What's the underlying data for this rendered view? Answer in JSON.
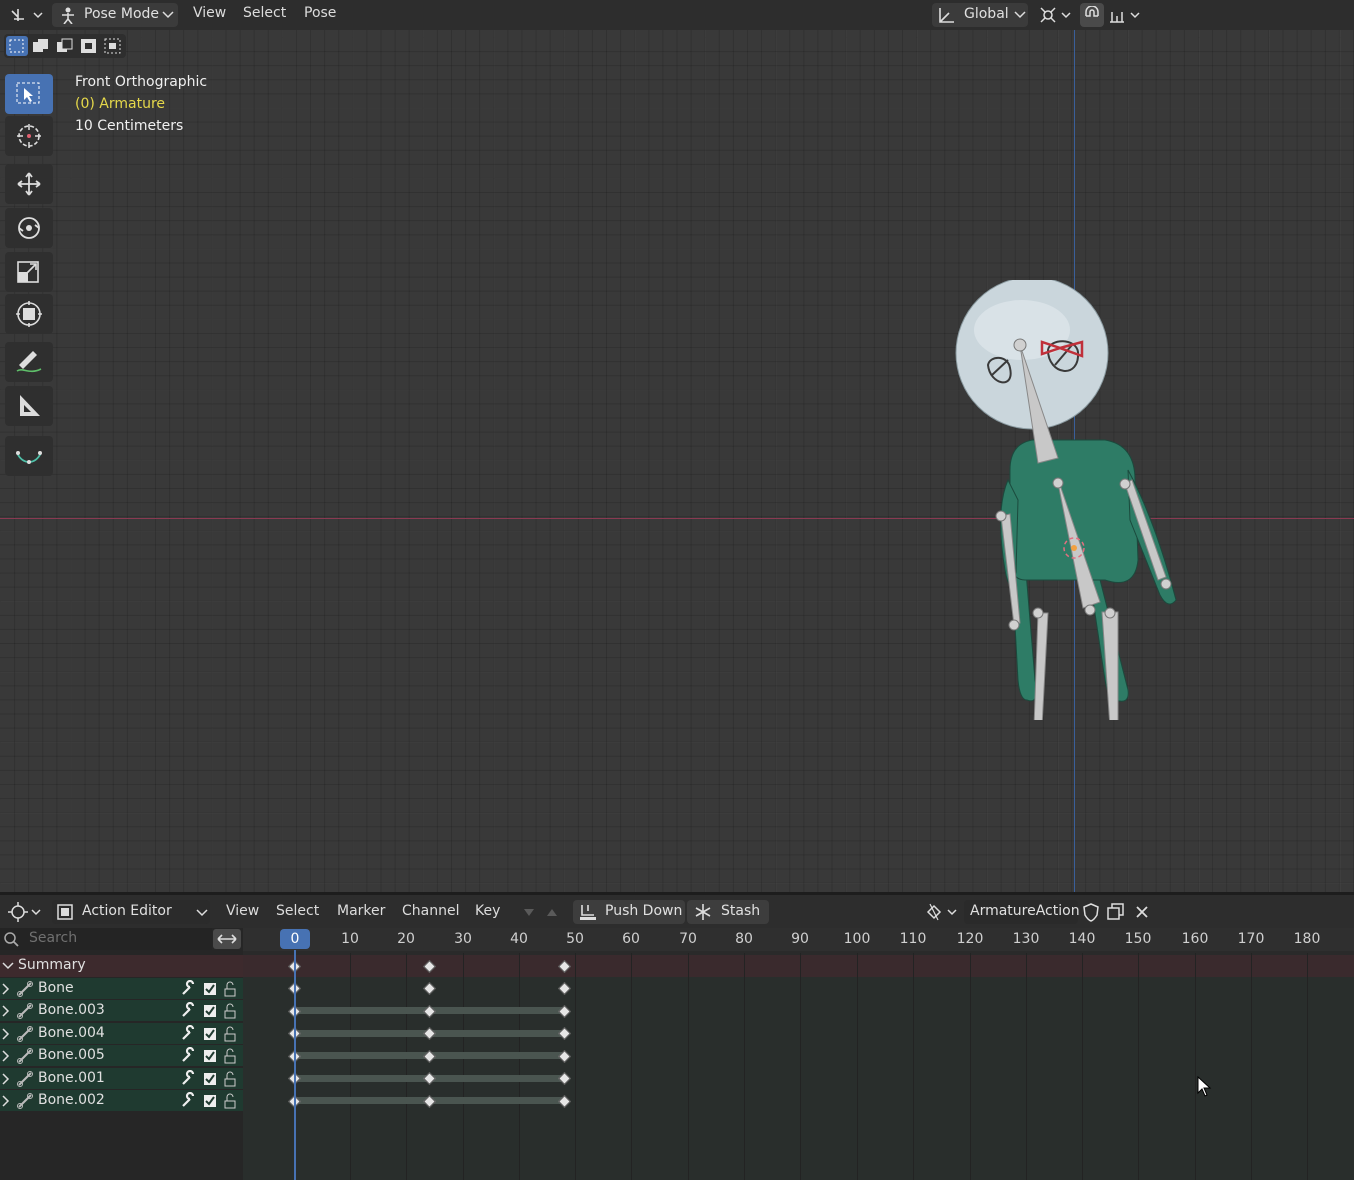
{
  "topbar": {
    "mode": "Pose Mode",
    "menus": [
      "View",
      "Select",
      "Pose"
    ],
    "orientation": "Global"
  },
  "viewport": {
    "view_name": "Front Orthographic",
    "object_name": "(0) Armature",
    "scale_text": "10 Centimeters"
  },
  "tools": [
    "select-box-icon",
    "cursor-icon",
    "move-icon",
    "rotate-icon",
    "scale-icon",
    "transform-icon",
    "annotate-icon",
    "measure-icon",
    "bone-envelope-icon"
  ],
  "dopesheet": {
    "editor_mode": "Action Editor",
    "menus": [
      "View",
      "Select",
      "Marker",
      "Channel",
      "Key"
    ],
    "push_down": "Push Down",
    "stash": "Stash",
    "action_name": "ArmatureAction",
    "search_placeholder": "Search",
    "current_frame": "0",
    "ruler": [
      "10",
      "20",
      "30",
      "40",
      "50",
      "60",
      "70",
      "80",
      "90",
      "100",
      "110",
      "120",
      "130",
      "140",
      "150",
      "160",
      "170",
      "180"
    ],
    "summary_label": "Summary",
    "channels": [
      "Bone",
      "Bone.003",
      "Bone.004",
      "Bone.005",
      "Bone.001",
      "Bone.002"
    ],
    "keyframes": [
      0,
      24,
      48
    ]
  },
  "colors": {
    "accent_blue": "#4772b3",
    "channel_green": "#1f3a30",
    "summary_red": "#3d2a2d",
    "text_yellow": "#e5d84a"
  }
}
